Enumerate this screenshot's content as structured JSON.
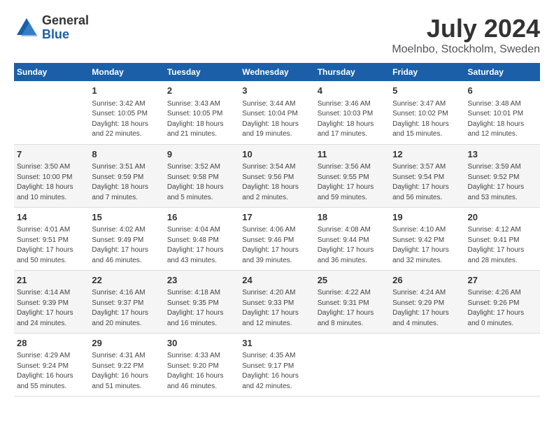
{
  "header": {
    "logo_general": "General",
    "logo_blue": "Blue",
    "month_title": "July 2024",
    "location": "Moelnbo, Stockholm, Sweden"
  },
  "weekdays": [
    "Sunday",
    "Monday",
    "Tuesday",
    "Wednesday",
    "Thursday",
    "Friday",
    "Saturday"
  ],
  "weeks": [
    [
      {
        "day": "",
        "info": ""
      },
      {
        "day": "1",
        "info": "Sunrise: 3:42 AM\nSunset: 10:05 PM\nDaylight: 18 hours\nand 22 minutes."
      },
      {
        "day": "2",
        "info": "Sunrise: 3:43 AM\nSunset: 10:05 PM\nDaylight: 18 hours\nand 21 minutes."
      },
      {
        "day": "3",
        "info": "Sunrise: 3:44 AM\nSunset: 10:04 PM\nDaylight: 18 hours\nand 19 minutes."
      },
      {
        "day": "4",
        "info": "Sunrise: 3:46 AM\nSunset: 10:03 PM\nDaylight: 18 hours\nand 17 minutes."
      },
      {
        "day": "5",
        "info": "Sunrise: 3:47 AM\nSunset: 10:02 PM\nDaylight: 18 hours\nand 15 minutes."
      },
      {
        "day": "6",
        "info": "Sunrise: 3:48 AM\nSunset: 10:01 PM\nDaylight: 18 hours\nand 12 minutes."
      }
    ],
    [
      {
        "day": "7",
        "info": "Sunrise: 3:50 AM\nSunset: 10:00 PM\nDaylight: 18 hours\nand 10 minutes."
      },
      {
        "day": "8",
        "info": "Sunrise: 3:51 AM\nSunset: 9:59 PM\nDaylight: 18 hours\nand 7 minutes."
      },
      {
        "day": "9",
        "info": "Sunrise: 3:52 AM\nSunset: 9:58 PM\nDaylight: 18 hours\nand 5 minutes."
      },
      {
        "day": "10",
        "info": "Sunrise: 3:54 AM\nSunset: 9:56 PM\nDaylight: 18 hours\nand 2 minutes."
      },
      {
        "day": "11",
        "info": "Sunrise: 3:56 AM\nSunset: 9:55 PM\nDaylight: 17 hours\nand 59 minutes."
      },
      {
        "day": "12",
        "info": "Sunrise: 3:57 AM\nSunset: 9:54 PM\nDaylight: 17 hours\nand 56 minutes."
      },
      {
        "day": "13",
        "info": "Sunrise: 3:59 AM\nSunset: 9:52 PM\nDaylight: 17 hours\nand 53 minutes."
      }
    ],
    [
      {
        "day": "14",
        "info": "Sunrise: 4:01 AM\nSunset: 9:51 PM\nDaylight: 17 hours\nand 50 minutes."
      },
      {
        "day": "15",
        "info": "Sunrise: 4:02 AM\nSunset: 9:49 PM\nDaylight: 17 hours\nand 46 minutes."
      },
      {
        "day": "16",
        "info": "Sunrise: 4:04 AM\nSunset: 9:48 PM\nDaylight: 17 hours\nand 43 minutes."
      },
      {
        "day": "17",
        "info": "Sunrise: 4:06 AM\nSunset: 9:46 PM\nDaylight: 17 hours\nand 39 minutes."
      },
      {
        "day": "18",
        "info": "Sunrise: 4:08 AM\nSunset: 9:44 PM\nDaylight: 17 hours\nand 36 minutes."
      },
      {
        "day": "19",
        "info": "Sunrise: 4:10 AM\nSunset: 9:42 PM\nDaylight: 17 hours\nand 32 minutes."
      },
      {
        "day": "20",
        "info": "Sunrise: 4:12 AM\nSunset: 9:41 PM\nDaylight: 17 hours\nand 28 minutes."
      }
    ],
    [
      {
        "day": "21",
        "info": "Sunrise: 4:14 AM\nSunset: 9:39 PM\nDaylight: 17 hours\nand 24 minutes."
      },
      {
        "day": "22",
        "info": "Sunrise: 4:16 AM\nSunset: 9:37 PM\nDaylight: 17 hours\nand 20 minutes."
      },
      {
        "day": "23",
        "info": "Sunrise: 4:18 AM\nSunset: 9:35 PM\nDaylight: 17 hours\nand 16 minutes."
      },
      {
        "day": "24",
        "info": "Sunrise: 4:20 AM\nSunset: 9:33 PM\nDaylight: 17 hours\nand 12 minutes."
      },
      {
        "day": "25",
        "info": "Sunrise: 4:22 AM\nSunset: 9:31 PM\nDaylight: 17 hours\nand 8 minutes."
      },
      {
        "day": "26",
        "info": "Sunrise: 4:24 AM\nSunset: 9:29 PM\nDaylight: 17 hours\nand 4 minutes."
      },
      {
        "day": "27",
        "info": "Sunrise: 4:26 AM\nSunset: 9:26 PM\nDaylight: 17 hours\nand 0 minutes."
      }
    ],
    [
      {
        "day": "28",
        "info": "Sunrise: 4:29 AM\nSunset: 9:24 PM\nDaylight: 16 hours\nand 55 minutes."
      },
      {
        "day": "29",
        "info": "Sunrise: 4:31 AM\nSunset: 9:22 PM\nDaylight: 16 hours\nand 51 minutes."
      },
      {
        "day": "30",
        "info": "Sunrise: 4:33 AM\nSunset: 9:20 PM\nDaylight: 16 hours\nand 46 minutes."
      },
      {
        "day": "31",
        "info": "Sunrise: 4:35 AM\nSunset: 9:17 PM\nDaylight: 16 hours\nand 42 minutes."
      },
      {
        "day": "",
        "info": ""
      },
      {
        "day": "",
        "info": ""
      },
      {
        "day": "",
        "info": ""
      }
    ]
  ],
  "colors": {
    "header_bg": "#1a5fa8",
    "header_text": "#ffffff",
    "odd_row": "#ffffff",
    "even_row": "#f5f5f5"
  }
}
